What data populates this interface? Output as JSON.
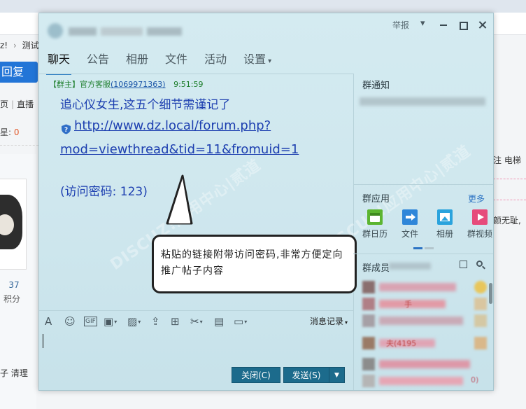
{
  "background": {
    "breadcrumb_a": "z!",
    "breadcrumb_sep": "›",
    "breadcrumb_b": "测试",
    "reply_button": "回复",
    "subnav_a": "页",
    "subnav_b": "直播",
    "stat_label": "星:",
    "stat_value": "0",
    "post_count": "37",
    "points_label": "积分",
    "clean_text": "子 清理",
    "right_text_1": "注 电梯",
    "right_text_2": "颜无耻,"
  },
  "window": {
    "report_label": "举报",
    "tabs": [
      {
        "label": "聊天"
      },
      {
        "label": "公告"
      },
      {
        "label": "相册"
      },
      {
        "label": "文件"
      },
      {
        "label": "活动"
      },
      {
        "label": "设置"
      }
    ]
  },
  "message": {
    "role": "【群主】",
    "sender": "官方客服",
    "sender_id": "(1069971363)",
    "time": "9:51:59",
    "title": "追心仪女生,这五个细节需谨记了",
    "link_line1": "http://www.dz.local/forum.php?",
    "link_line2": "mod=viewthread&tid=11&fromuid=1",
    "password_line": "(访问密码: 123)"
  },
  "watermarks": [
    "DISCUZ!应用中心|贰道",
    "DISCUZ!应用中心|贰道"
  ],
  "callout": {
    "text": "粘贴的链接附带访问密码,非常方便定向推广帖子内容"
  },
  "toolbar": {
    "gif_label": "GIF",
    "history_label": "消息记录"
  },
  "buttons": {
    "close": "关闭(C)",
    "send": "发送(S)"
  },
  "right_panel": {
    "notice_title": "群通知",
    "apps_title": "群应用",
    "more_label": "更多",
    "apps": [
      {
        "label": "群日历",
        "icon": "calendar-icon",
        "color": "#5cb531"
      },
      {
        "label": "文件",
        "icon": "file-share-icon",
        "color": "#2f86d9"
      },
      {
        "label": "相册",
        "icon": "album-icon",
        "color": "#2aa3dd"
      },
      {
        "label": "群视频",
        "icon": "video-icon",
        "color": "#e64b7b"
      }
    ],
    "members_title": "群成员",
    "members": [
      {
        "text": "手"
      },
      {
        "text": "夫(4195"
      },
      {
        "text": "0)"
      }
    ]
  },
  "colors": {
    "accent": "#1c6b8c",
    "link": "#1d3fb0",
    "sender_green": "#1c7e2b"
  }
}
